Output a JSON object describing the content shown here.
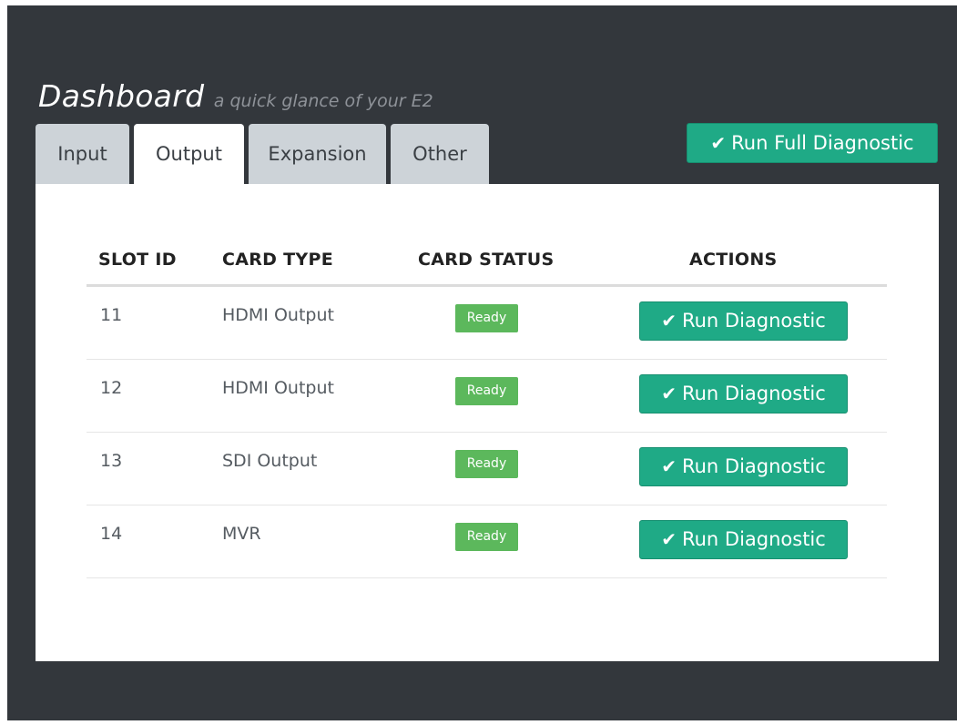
{
  "header": {
    "title": "Dashboard",
    "subtitle": "a quick glance of your E2"
  },
  "tabs": [
    {
      "label": "Input",
      "active": false
    },
    {
      "label": "Output",
      "active": true
    },
    {
      "label": "Expansion",
      "active": false
    },
    {
      "label": "Other",
      "active": false
    }
  ],
  "actions": {
    "full_diagnostic_label": "Run Full Diagnostic",
    "check_icon": "check-icon"
  },
  "table": {
    "columns": [
      "SLOT ID",
      "CARD TYPE",
      "CARD STATUS",
      "ACTIONS"
    ],
    "rows": [
      {
        "slot": "11",
        "type": "HDMI Output",
        "status": "Ready",
        "action": "Run Diagnostic"
      },
      {
        "slot": "12",
        "type": "HDMI Output",
        "status": "Ready",
        "action": "Run Diagnostic"
      },
      {
        "slot": "13",
        "type": "SDI Output",
        "status": "Ready",
        "action": "Run Diagnostic"
      },
      {
        "slot": "14",
        "type": "MVR",
        "status": "Ready",
        "action": "Run Diagnostic"
      }
    ]
  },
  "colors": {
    "background": "#33373c",
    "accent": "#1faa86",
    "status_ready": "#5cb85c",
    "tab_inactive": "#cdd3d8"
  }
}
